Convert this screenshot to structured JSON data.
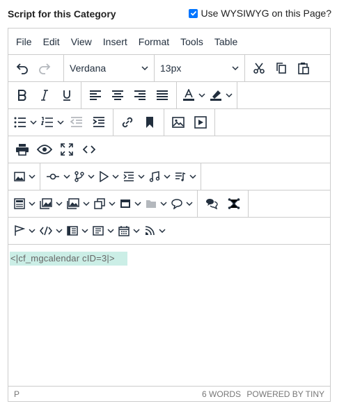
{
  "header": {
    "title": "Script for this Category",
    "wysiwyg_label": "Use WYSIWYG on this Page?",
    "wysiwyg_checked": true
  },
  "menubar": [
    "File",
    "Edit",
    "View",
    "Insert",
    "Format",
    "Tools",
    "Table"
  ],
  "toolbar": {
    "font_family": "Verdana",
    "font_size": "13px"
  },
  "content": {
    "shortcode": "<|cf_mgcalendar cID=3|>"
  },
  "statusbar": {
    "path": "P",
    "word_count": "6 WORDS",
    "powered_by": "POWERED BY TINY"
  },
  "colors": {
    "accent": "#0075ff",
    "shortcode_bg": "#cbeee6",
    "border": "#cccccc",
    "icon": "#222f3e"
  }
}
